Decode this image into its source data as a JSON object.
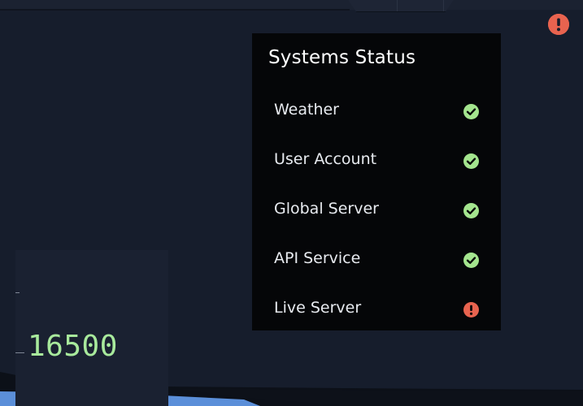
{
  "global_alert": {
    "icon": "exclamation-circle-icon",
    "color": "#e8634f"
  },
  "status_panel": {
    "title": "Systems Status",
    "background": "#050608",
    "items": [
      {
        "label": "Weather",
        "status": "ok",
        "icon": "check-circle-icon"
      },
      {
        "label": "User Account",
        "status": "ok",
        "icon": "check-circle-icon"
      },
      {
        "label": "Global Server",
        "status": "ok",
        "icon": "check-circle-icon"
      },
      {
        "label": "API Service",
        "status": "ok",
        "icon": "check-circle-icon"
      },
      {
        "label": "Live Server",
        "status": "error",
        "icon": "exclamation-circle-icon"
      }
    ],
    "colors": {
      "ok": "#a4e58e",
      "error": "#e8634f"
    }
  },
  "gauge": {
    "value": "16500",
    "value_color": "#a8ea9c"
  }
}
